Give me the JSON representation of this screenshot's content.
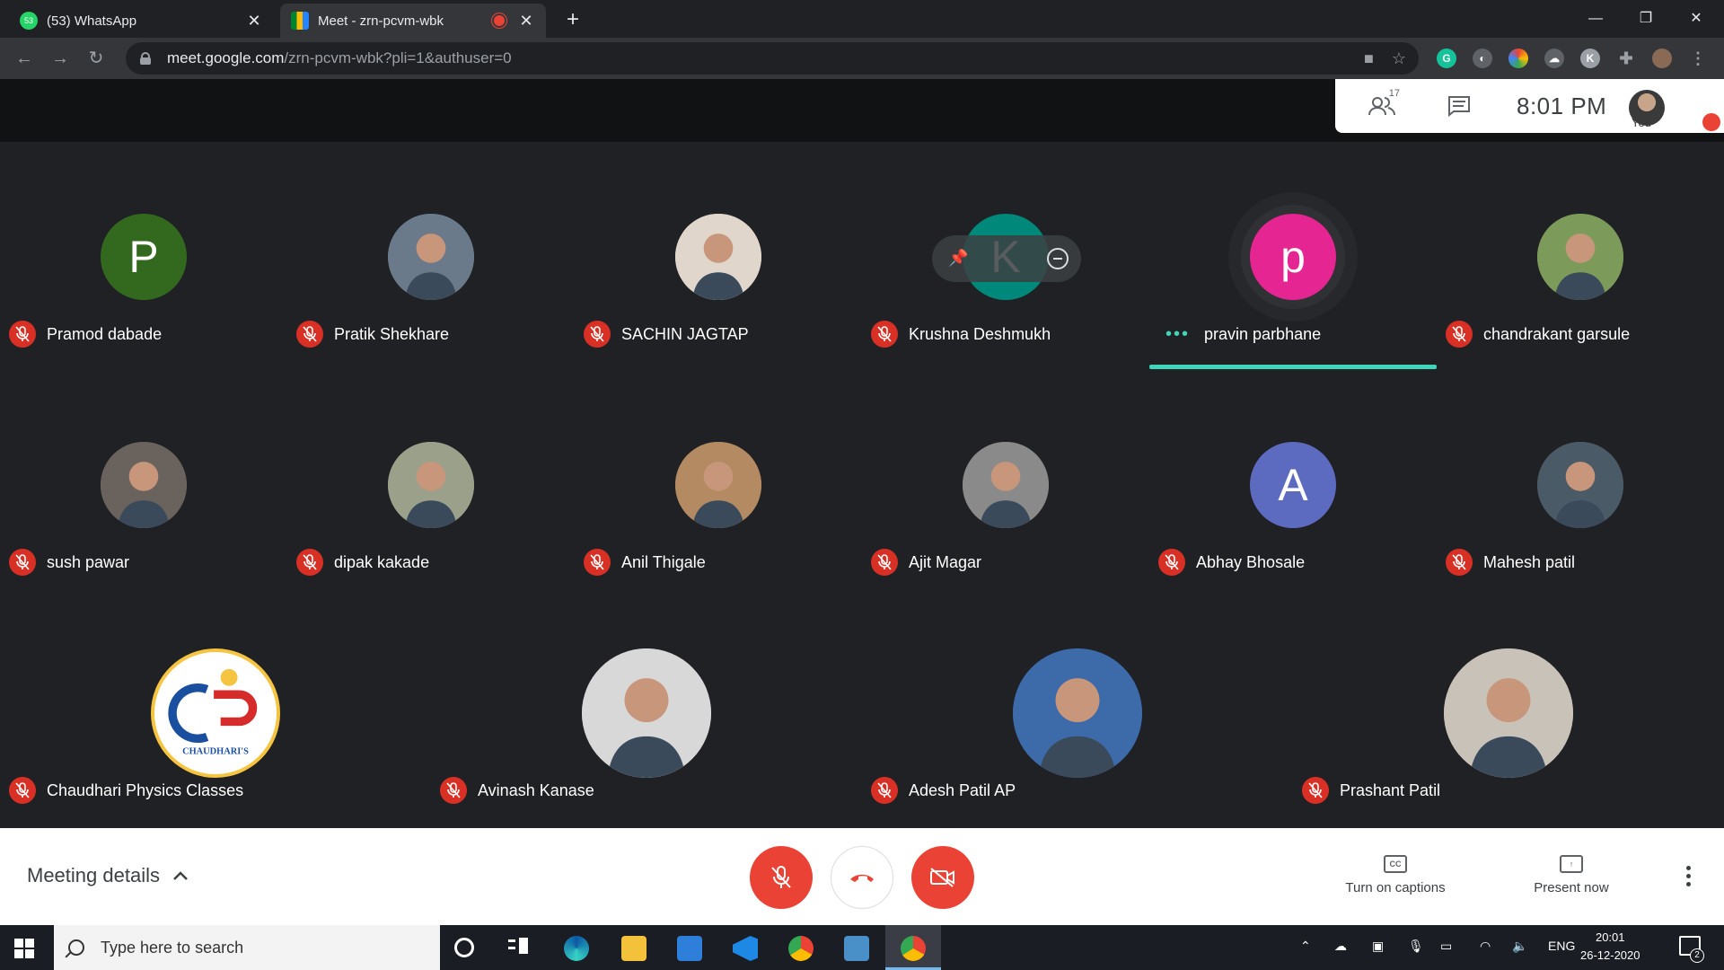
{
  "browser": {
    "tabs": [
      {
        "title": "(53) WhatsApp",
        "favicon": "whatsapp-icon",
        "color": "#25d366",
        "badge": "53"
      },
      {
        "title": "Meet - zrn-pcvm-wbk",
        "favicon": "meet-icon",
        "recording": true
      }
    ],
    "url_host": "meet.google.com",
    "url_path": "/zrn-pcvm-wbk?pli=1&authuser=0"
  },
  "meet": {
    "participant_count": "17",
    "time": "8:01 PM",
    "you_label": "You",
    "participants": [
      {
        "name": "Pramod dabade",
        "initial": "P",
        "bg": "#33691e",
        "muted": true
      },
      {
        "name": "Pratik Shekhare",
        "initial": "",
        "bg": "#6b7a8a",
        "muted": true,
        "photo": true
      },
      {
        "name": "SACHIN JAGTAP",
        "initial": "",
        "bg": "#e0d6cc",
        "muted": true,
        "photo": true
      },
      {
        "name": "Krushna Deshmukh",
        "initial": "K",
        "bg": "#00897b",
        "muted": true
      },
      {
        "name": "pravin parbhane",
        "initial": "p",
        "bg": "#e52592",
        "muted": false,
        "speaking": true
      },
      {
        "name": "chandrakant garsule",
        "initial": "",
        "bg": "#7c9a5a",
        "muted": true,
        "photo": true
      },
      {
        "name": "sush pawar",
        "initial": "",
        "bg": "#6a625c",
        "muted": true,
        "photo": true
      },
      {
        "name": "dipak kakade",
        "initial": "",
        "bg": "#9aa08a",
        "muted": true,
        "photo": true
      },
      {
        "name": "Anil Thigale",
        "initial": "",
        "bg": "#b48a62",
        "muted": true,
        "photo": true
      },
      {
        "name": "Ajit Magar",
        "initial": "",
        "bg": "#8a8a8a",
        "muted": true,
        "photo": true
      },
      {
        "name": "Abhay Bhosale",
        "initial": "A",
        "bg": "#5c6bc0",
        "muted": true
      },
      {
        "name": "Mahesh patil",
        "initial": "",
        "bg": "#4a5a66",
        "muted": true,
        "photo": true
      },
      {
        "name": "Chaudhari Physics Classes",
        "initial": "",
        "bg": "#ffffff",
        "muted": true,
        "logo": true,
        "logo_text": "CHAUDHARI'S"
      },
      {
        "name": "Avinash Kanase",
        "initial": "",
        "bg": "#d8d8d8",
        "muted": true,
        "photo": true
      },
      {
        "name": "Adesh Patil AP",
        "initial": "",
        "bg": "#3d6aa8",
        "muted": true,
        "photo": true
      },
      {
        "name": "Prashant Patil",
        "initial": "",
        "bg": "#c9c2b8",
        "muted": true,
        "photo": true
      }
    ],
    "meeting_details_label": "Meeting details",
    "captions_label": "Turn on captions",
    "present_label": "Present now"
  },
  "taskbar": {
    "search_placeholder": "Type here to search",
    "language": "ENG",
    "time": "20:01",
    "date": "26-12-2020",
    "notification_count": "2"
  }
}
